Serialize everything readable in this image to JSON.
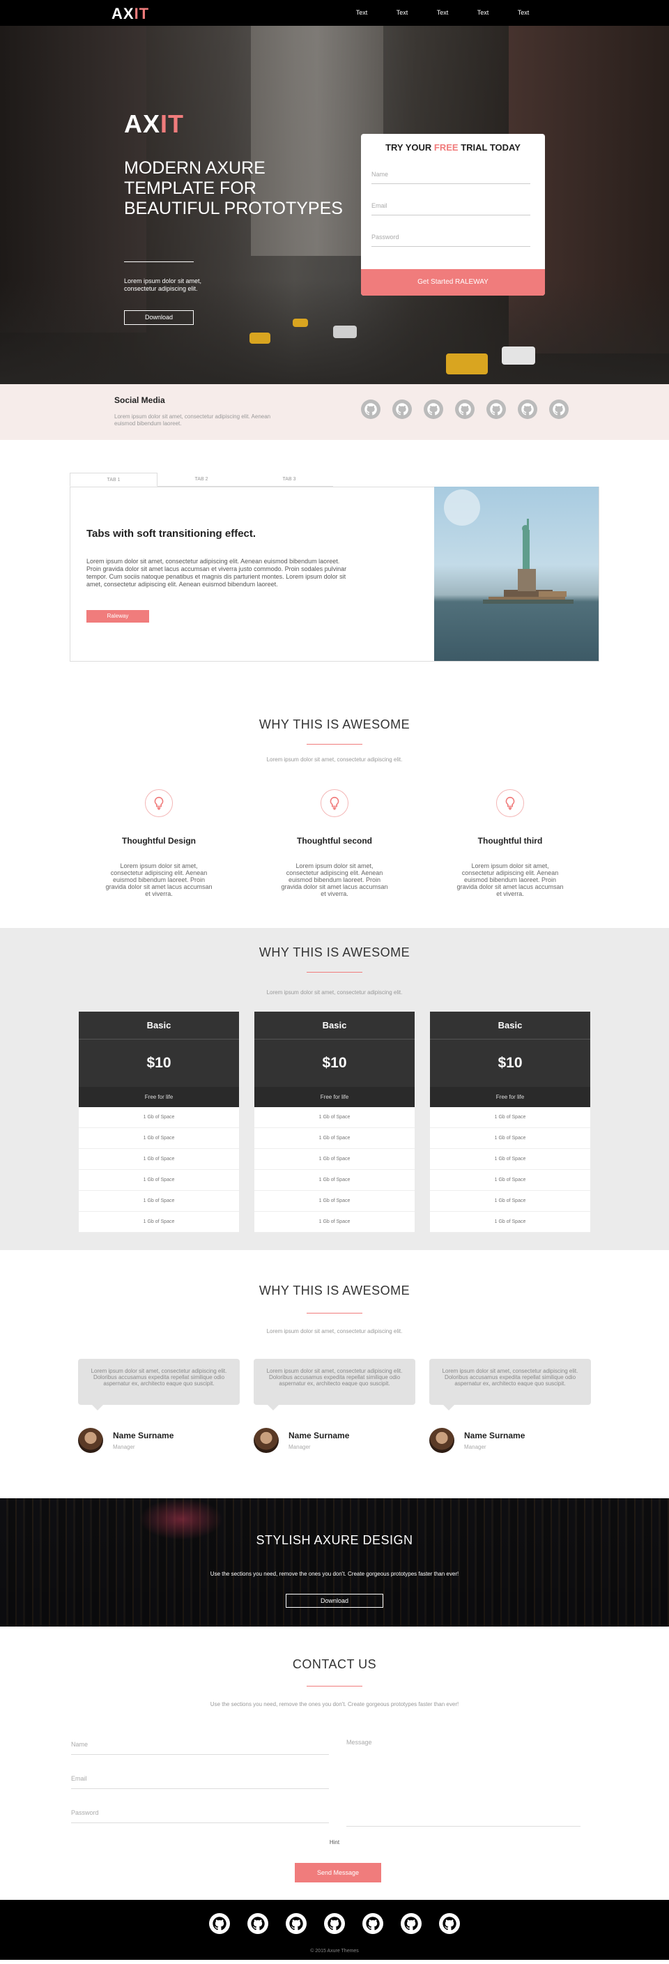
{
  "nav": {
    "logo_a": "AX",
    "logo_b": "IT",
    "links": [
      "Text",
      "Text",
      "Text",
      "Text",
      "Text"
    ]
  },
  "hero": {
    "logo_a": "AX",
    "logo_b": "IT",
    "title": "MODERN AXURE TEMPLATE FOR BEAUTIFUL PROTOTYPES",
    "text": "Lorem ipsum dolor sit amet, consectetur adipiscing elit.",
    "download_label": "Download",
    "trial": {
      "title_a": "TRY YOUR ",
      "title_b": "FREE",
      "title_c": " TRIAL TODAY",
      "name_placeholder": "Name",
      "email_placeholder": "Email",
      "password_placeholder": "Password",
      "cta_label": "Get Started RALEWAY"
    }
  },
  "social": {
    "title": "Social Media",
    "text": "Lorem ipsum dolor sit amet, consectetur adipiscing elit. Aenean euismod bibendum laoreet.",
    "icon_count_label": ""
  },
  "tabs": {
    "labels": [
      "TAB 1",
      "TAB 2",
      "TAB 3"
    ],
    "heading": "Tabs with soft transitioning effect.",
    "body": "Lorem ipsum dolor sit amet, consectetur adipiscing elit. Aenean euismod bibendum laoreet. Proin gravida dolor sit amet lacus accumsan et viverra justo commodo. Proin sodales pulvinar tempor. Cum sociis natoque penatibus et magnis dis parturient montes. Lorem ipsum dolor sit amet, consectetur adipiscing elit. Aenean euismod bibendum laoreet.",
    "button_label": "Raleway"
  },
  "features": {
    "title": "WHY THIS IS AWESOME",
    "subtitle": "Lorem ipsum dolor sit amet, consectetur adipiscing elit.",
    "items": [
      {
        "title": "Thoughtful Design",
        "text": "Lorem ipsum dolor sit amet, consectetur adipiscing elit. Aenean euismod bibendum laoreet. Proin gravida dolor sit amet lacus accumsan et viverra."
      },
      {
        "title": "Thoughtful second",
        "text": "Lorem ipsum dolor sit amet, consectetur adipiscing elit. Aenean euismod bibendum laoreet. Proin gravida dolor sit amet lacus accumsan et viverra."
      },
      {
        "title": "Thoughtful third",
        "text": "Lorem ipsum dolor sit amet, consectetur adipiscing elit. Aenean euismod bibendum laoreet. Proin gravida dolor sit amet lacus accumsan et viverra."
      }
    ]
  },
  "pricing": {
    "title": "WHY THIS IS AWESOME",
    "subtitle": "Lorem ipsum dolor sit amet, consectetur adipiscing elit.",
    "plans": [
      {
        "name": "Basic",
        "price": "$10",
        "note": "Free for life",
        "rows": [
          "1 Gb of Space",
          "1 Gb of Space",
          "1 Gb of Space",
          "1 Gb of Space",
          "1 Gb of Space",
          "1 Gb of Space"
        ]
      },
      {
        "name": "Basic",
        "price": "$10",
        "note": "Free for life",
        "rows": [
          "1 Gb of Space",
          "1 Gb of Space",
          "1 Gb of Space",
          "1 Gb of Space",
          "1 Gb of Space",
          "1 Gb of Space"
        ]
      },
      {
        "name": "Basic",
        "price": "$10",
        "note": "Free for life",
        "rows": [
          "1 Gb of Space",
          "1 Gb of Space",
          "1 Gb of Space",
          "1 Gb of Space",
          "1 Gb of Space",
          "1 Gb of Space"
        ]
      }
    ]
  },
  "testimonials": {
    "title": "WHY THIS IS AWESOME",
    "subtitle": "Lorem ipsum dolor sit amet, consectetur adipiscing elit.",
    "items": [
      {
        "quote": "Lorem ipsum dolor sit amet, consectetur adipiscing elit. Doloribus accusamus expedita repellat similique odio aspernatur ex, architecto eaque quo suscipit.",
        "name": "Name Surname",
        "role": "Manager"
      },
      {
        "quote": "Lorem ipsum dolor sit amet, consectetur adipiscing elit. Doloribus accusamus expedita repellat similique odio aspernatur ex, architecto eaque quo suscipit.",
        "name": "Name Surname",
        "role": "Manager"
      },
      {
        "quote": "Lorem ipsum dolor sit amet, consectetur adipiscing elit. Doloribus accusamus expedita repellat similique odio aspernatur ex, architecto eaque quo suscipit.",
        "name": "Name Surname",
        "role": "Manager"
      }
    ]
  },
  "banner": {
    "title": "STYLISH AXURE DESIGN",
    "text": "Use the sections you need, remove the ones you don't. Create gorgeous prototypes faster than ever!",
    "download_label": "Download"
  },
  "contact": {
    "title": "CONTACT US",
    "subtitle": "Use the sections you need, remove the ones you don't. Create gorgeous prototypes faster than ever!",
    "name_placeholder": "Name",
    "email_placeholder": "Email",
    "password_placeholder": "Password",
    "message_placeholder": "Message",
    "hint": "Hint",
    "send_label": "Send Message"
  },
  "footer": {
    "copyright": "© 2015 Axure Themes"
  },
  "colors": {
    "accent": "#f07c7c",
    "dark": "#333333",
    "nav": "#000000"
  }
}
